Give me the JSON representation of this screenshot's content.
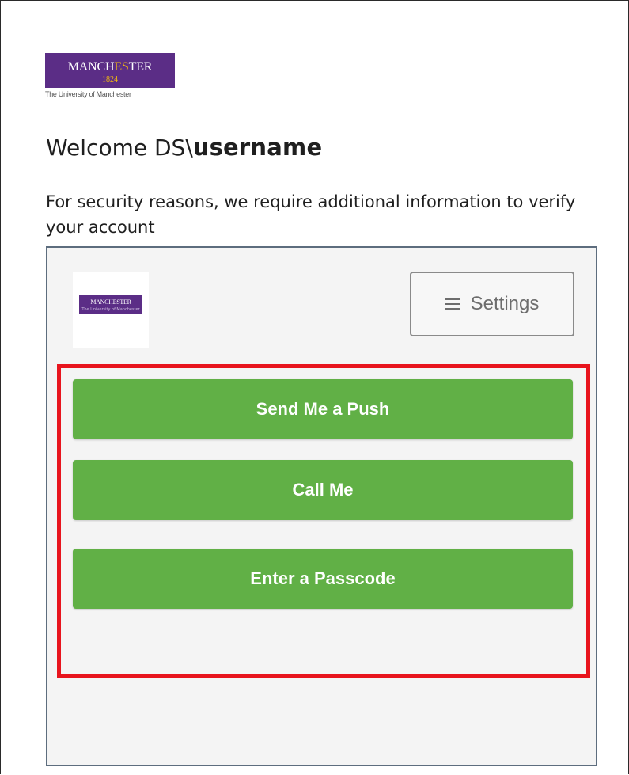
{
  "logo": {
    "name_prefix": "MANCH",
    "name_gold1": "E",
    "name_mid1": "S",
    "name_gold2": "T",
    "name_suffix": "ER",
    "year": "1824",
    "subtitle": "The University of Manchester"
  },
  "welcome": {
    "prefix": "Welcome DS\\",
    "username": "username"
  },
  "intro": "For security reasons, we require additional information to verify your account",
  "duo": {
    "logo_text": "MANCHESTER",
    "logo_sub": "The University of Manchester",
    "settings_label": "Settings",
    "actions": [
      {
        "label": "Send Me a Push"
      },
      {
        "label": "Call Me"
      },
      {
        "label": "Enter a Passcode"
      }
    ]
  },
  "colors": {
    "brand_purple": "#5b2d86",
    "brand_gold": "#f2b90f",
    "action_green": "#61b046",
    "highlight_red": "#e8141d"
  },
  "icons": [
    "menu-icon"
  ]
}
